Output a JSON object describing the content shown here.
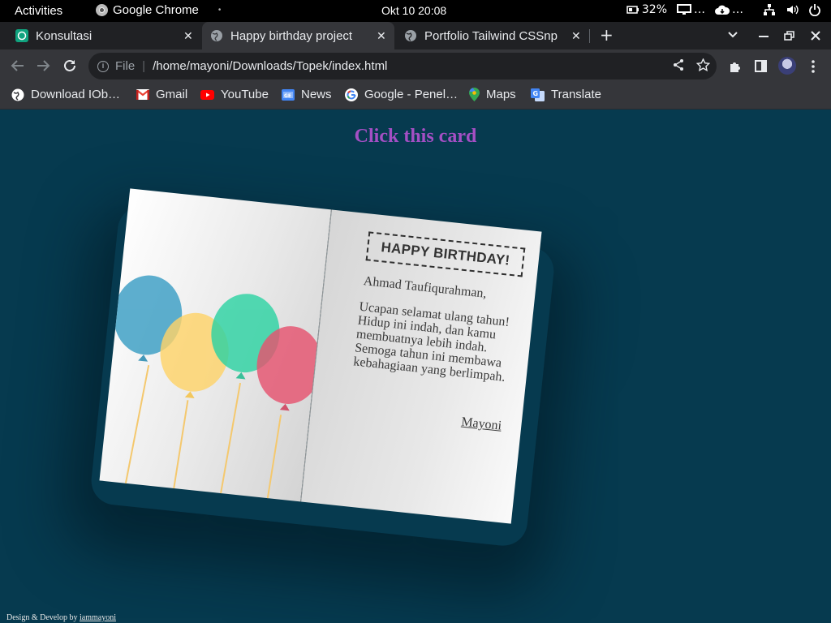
{
  "system_bar": {
    "activities": "Activities",
    "app_name": "Google Chrome",
    "clock": "Okt 10  20:08",
    "battery": "32%"
  },
  "tabs": [
    {
      "title": "Konsultasi",
      "close": "✕",
      "favicon": "chatgpt-icon"
    },
    {
      "title": "Happy birthday project",
      "close": "✕",
      "favicon": "globe-icon"
    },
    {
      "title": "Portfolio Tailwind CSSnp",
      "close": "✕",
      "favicon": "globe-icon"
    }
  ],
  "omnibox": {
    "scheme": "File",
    "url": "/home/mayoni/Downloads/Topek/index.html"
  },
  "bookmarks": [
    {
      "label": "Download IOb…",
      "icon": "globe-icon",
      "color": "#ffffff"
    },
    {
      "label": "Gmail",
      "icon": "gmail-icon",
      "color": "#ea4335"
    },
    {
      "label": "YouTube",
      "icon": "youtube-icon",
      "color": "#ff0000"
    },
    {
      "label": "News",
      "icon": "news-icon",
      "color": "#4285f4"
    },
    {
      "label": "Google - Penel…",
      "icon": "google-icon",
      "color": "#4285f4"
    },
    {
      "label": "Maps",
      "icon": "maps-icon",
      "color": "#34a853"
    },
    {
      "label": "Translate",
      "icon": "translate-icon",
      "color": "#4285f4"
    }
  ],
  "page": {
    "title": "Click this card",
    "card": {
      "heading": "HAPPY BIRTHDAY!",
      "greeting": "Ahmad Taufiqurahman,",
      "message_lines": [
        "Ucapan selamat ulang tahun!",
        "Hidup ini indah, dan kamu",
        "membuatnya lebih indah.",
        "Semoga tahun ini membawa",
        "kebahagiaan yang berlimpah."
      ],
      "signature": "Mayoni",
      "balloon_colors": [
        "#3a9ec4",
        "#fed36a",
        "#2ed3a3",
        "#e6536f"
      ]
    },
    "footer_text": "Design & Develop by ",
    "footer_link": "iammayoni"
  }
}
